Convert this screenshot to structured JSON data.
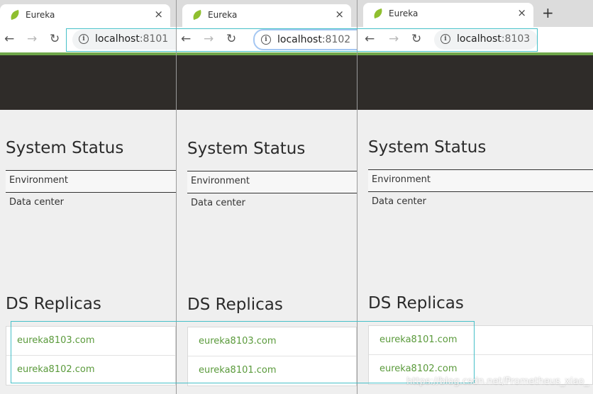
{
  "windows": [
    {
      "tab_title": "Eureka",
      "url_host": "localhost",
      "url_port": ":8101",
      "system_status_heading": "System Status",
      "environment_label": "Environment",
      "data_center_label": "Data center",
      "ds_replicas_heading": "DS Replicas",
      "replicas": [
        "eureka8103.com",
        "eureka8102.com"
      ]
    },
    {
      "tab_title": "Eureka",
      "url_host": "localhost",
      "url_port": ":8102",
      "system_status_heading": "System Status",
      "environment_label": "Environment",
      "data_center_label": "Data center",
      "ds_replicas_heading": "DS Replicas",
      "replicas": [
        "eureka8103.com",
        "eureka8101.com"
      ]
    },
    {
      "tab_title": "Eureka",
      "url_host": "localhost",
      "url_port": ":8103",
      "system_status_heading": "System Status",
      "environment_label": "Environment",
      "data_center_label": "Data center",
      "ds_replicas_heading": "DS Replicas",
      "replicas": [
        "eureka8101.com",
        "eureka8102.com"
      ]
    }
  ],
  "icons": {
    "close": "×",
    "new_tab": "+",
    "back": "←",
    "forward": "→",
    "reload": "↻",
    "info": "i"
  },
  "colors": {
    "navbar": "#2f2c29",
    "accent_green": "#6fa64a",
    "link_green": "#5a9a3b",
    "highlight": "#45c0c8"
  },
  "watermark": "https://blog.csdn.net/Prometheus_xiao_"
}
